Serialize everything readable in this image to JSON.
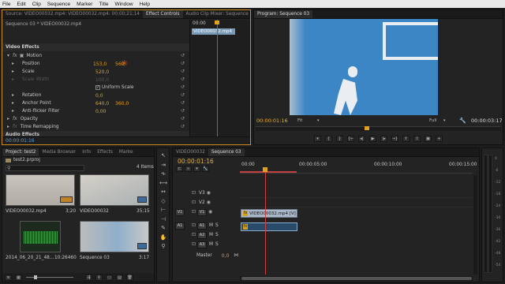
{
  "menu": [
    "File",
    "Edit",
    "Clip",
    "Sequence",
    "Marker",
    "Title",
    "Window",
    "Help"
  ],
  "source_tabs": [
    "Source: VIDEO00032.mp4: VIDEO00032.mp4: 00;00;21;14",
    "Effect Controls",
    "Audio Clip Mixer: Sequence 03"
  ],
  "effect_controls": {
    "header": "Sequence 03 * VIDEO00032.mp4",
    "timecode_head": "00:00",
    "clip_label": "VIDEO00032.mp4",
    "video_effects": "Video Effects",
    "motion": "Motion",
    "position": "Position",
    "position_x": "153,0",
    "position_y": "560",
    "scale": "Scale",
    "scale_val": "520,0",
    "scale_width": "Scale Width",
    "scale_width_val": "100,0",
    "uniform_scale": "Uniform Scale",
    "rotation": "Rotation",
    "rotation_val": "0,0",
    "anchor": "Anchor Point",
    "anchor_x": "640,0",
    "anchor_y": "360,0",
    "antiflicker": "Anti-flicker Filter",
    "antiflicker_val": "0,00",
    "opacity": "Opacity",
    "time_remap": "Time Remapping",
    "audio_effects": "Audio Effects",
    "timecode": "00:00:01:16"
  },
  "program": {
    "tab": "Program: Sequence 03",
    "timecode": "00:00:01:16",
    "fit": "Fit",
    "quality": "Full",
    "duration": "00:00:03:17"
  },
  "project": {
    "tabs": [
      "Project: test2",
      "Media Browser",
      "Info",
      "Effects",
      "Marke"
    ],
    "file": "test2.prproj",
    "count": "4 Items",
    "items": [
      {
        "name": "VIDEO00032.mp4",
        "dur": "3;20"
      },
      {
        "name": "VIDEO00032",
        "dur": "35;15"
      },
      {
        "name": "2014_06_20_21_48...",
        "dur": "10:26460"
      },
      {
        "name": "Sequence 03",
        "dur": "3:17"
      }
    ]
  },
  "timeline": {
    "tabs": [
      "VIDEO00032",
      "Sequence 03"
    ],
    "timecode": "00:00:01:16",
    "ruler": [
      "00:00",
      "00:00:05:00",
      "00:00:10:00",
      "00:00:15:00"
    ],
    "tracks_video": [
      "V3",
      "V2",
      "V1"
    ],
    "tracks_audio": [
      "A1",
      "A2",
      "A3"
    ],
    "src_v": "V1",
    "src_a": "A1",
    "clip_label": "VIDEO00032.mp4 [V]",
    "master": "Master",
    "master_val": "0,0"
  },
  "meter_labels": [
    "0",
    "-6",
    "-12",
    "-18",
    "-24",
    "-30",
    "-36",
    "-42",
    "-48",
    "-54"
  ]
}
